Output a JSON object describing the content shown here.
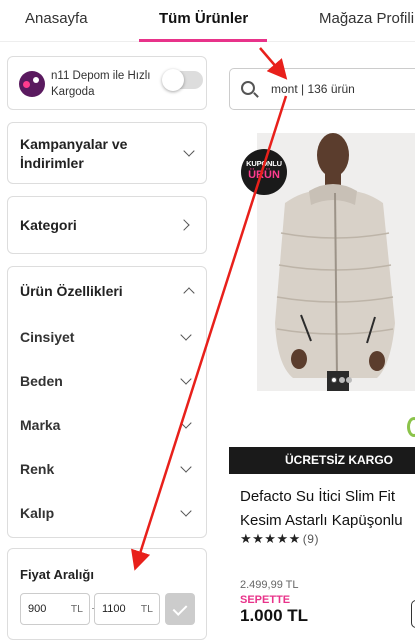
{
  "tabs": [
    {
      "label": "Anasayfa"
    },
    {
      "label": "Tüm Ürünler"
    },
    {
      "label": "Mağaza Profili"
    }
  ],
  "depom": {
    "text": "n11 Depom ile Hızlı Kargoda",
    "toggle_on": false
  },
  "filters": {
    "kampanya": "Kampanyalar ve İndirimler",
    "kategori": "Kategori",
    "ozellikler": "Ürün Özellikleri",
    "sub_items": [
      "Cinsiyet",
      "Beden",
      "Marka",
      "Renk",
      "Kalıp"
    ]
  },
  "fiyat": {
    "title": "Fiyat Aralığı",
    "min": "900",
    "max": "1100",
    "unit": "TL"
  },
  "search": {
    "text": "mont | 136 ürün"
  },
  "product": {
    "kupon_line1": "KUPONLU",
    "kupon_line2": "ÜRÜN",
    "kargo": "ÜCRETSİZ KARGO",
    "name_line1": "Defacto Su İtici Slim Fit",
    "name_line2": "Kesim Astarlı Kapüşonlu",
    "stars": "★★★★★",
    "review_count": "(9)",
    "old_price": "2.499,99 TL",
    "sepette": "SEPETTE",
    "new_price": "1.000 TL",
    "image_page": "1 of 3"
  },
  "colors": {
    "accent": "#e8338a",
    "annotation": "#e8201b",
    "dark": "#1a1a1a"
  }
}
